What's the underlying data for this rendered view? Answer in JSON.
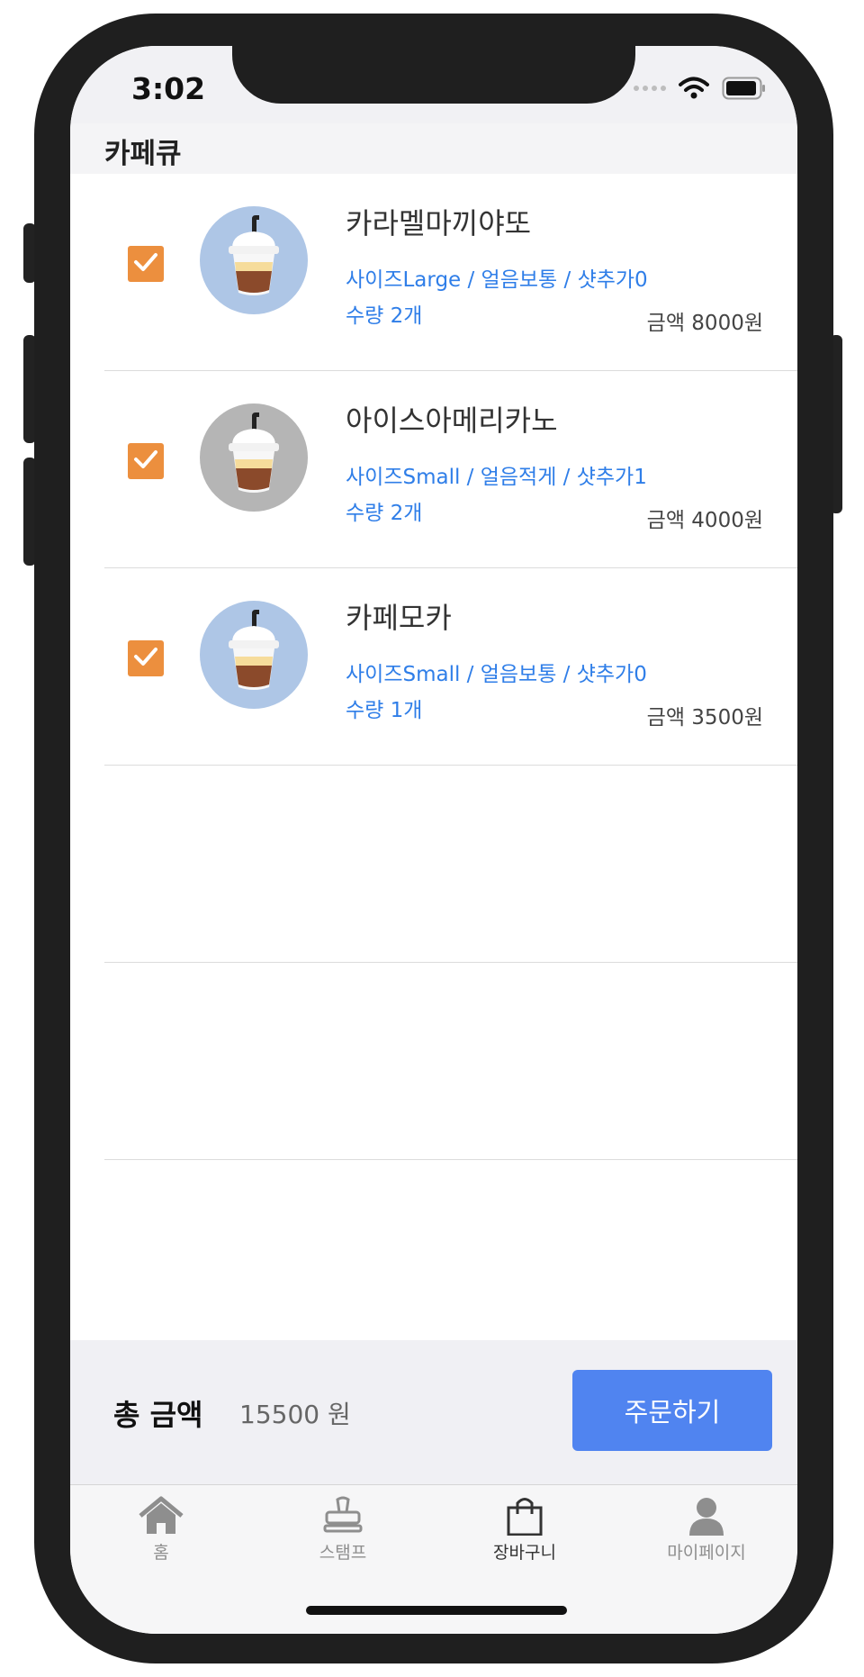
{
  "status_bar": {
    "time": "3:02"
  },
  "app_bar": {
    "title": "카페큐"
  },
  "cart_items": [
    {
      "name": "카라멜마끼야또",
      "options": "사이즈Large / 얼음보통 / 샷추가0",
      "quantity": "수량 2개",
      "price": "금액 8000원",
      "checked": true,
      "avatar_color": "#aec6e6"
    },
    {
      "name": "아이스아메리카노",
      "options": "사이즈Small / 얼음적게 / 샷추가1",
      "quantity": "수량 2개",
      "price": "금액 4000원",
      "checked": true,
      "avatar_color": "#b5b5b5"
    },
    {
      "name": "카페모카",
      "options": "사이즈Small / 얼음보통 / 샷추가0",
      "quantity": "수량 1개",
      "price": "금액 3500원",
      "checked": true,
      "avatar_color": "#aec6e6"
    }
  ],
  "footer": {
    "total_label": "총 금액",
    "total_value": "15500 원",
    "order_button": "주문하기"
  },
  "tabs": [
    {
      "label": "홈",
      "icon": "home-icon"
    },
    {
      "label": "스탬프",
      "icon": "stamp-icon"
    },
    {
      "label": "장바구니",
      "icon": "shopping-bag-icon",
      "active": true
    },
    {
      "label": "마이페이지",
      "icon": "person-icon"
    }
  ],
  "colors": {
    "accent": "#5084f0",
    "checkbox": "#ec8f3e",
    "option_text": "#2f7ee8"
  }
}
